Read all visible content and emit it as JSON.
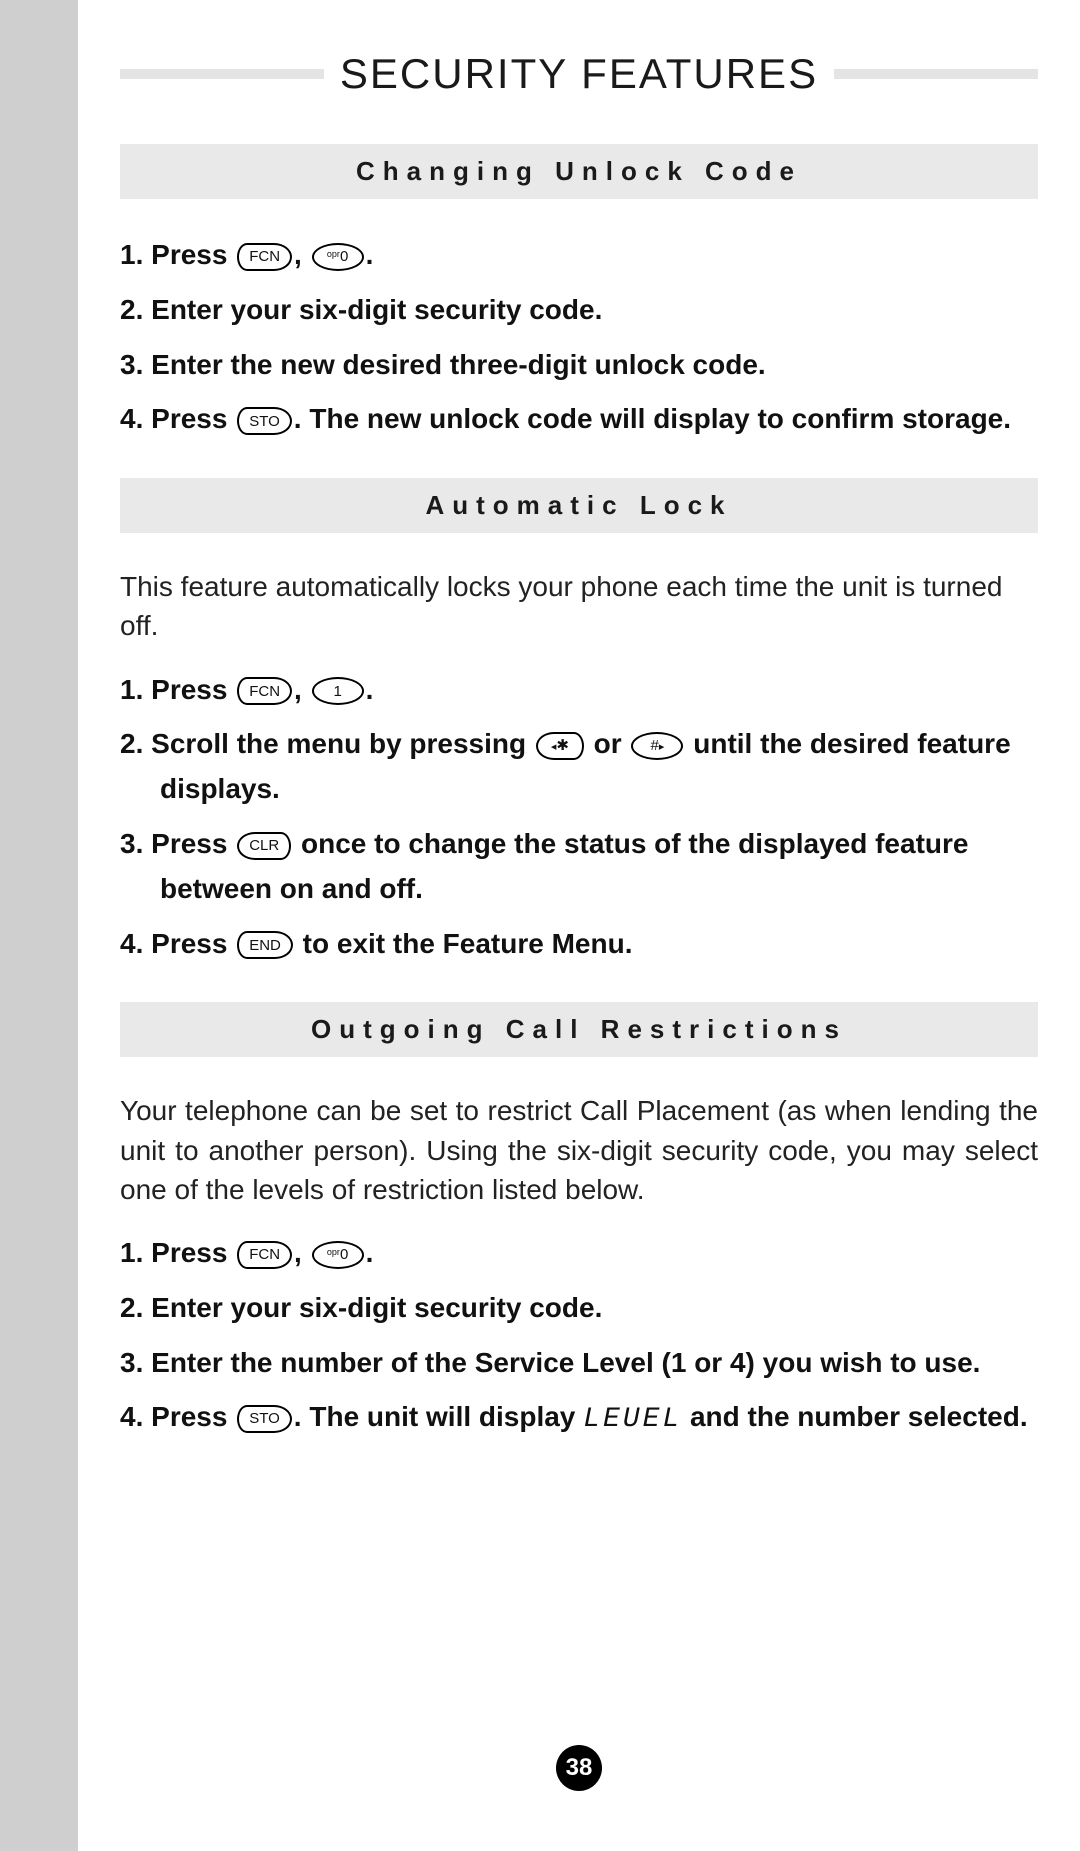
{
  "page_title": "SECURITY FEATURES",
  "page_number": "38",
  "keys": {
    "fcn": "FCN",
    "sto": "STO",
    "clr": "CLR",
    "end": "END",
    "zero_sup": "opr",
    "zero": "0",
    "one": "1",
    "star": "✱",
    "hash": "#"
  },
  "sections": {
    "changing": {
      "heading": "Changing Unlock Code",
      "steps": {
        "s1_a": "Press ",
        "s1_b": ", ",
        "s1_c": ".",
        "s2": "Enter your six-digit security code.",
        "s3": "Enter the new desired three-digit unlock code.",
        "s4_a": "Press ",
        "s4_b": ". The new unlock code will display to confirm storage."
      }
    },
    "auto": {
      "heading": "Automatic Lock",
      "intro": "This feature automatically locks your phone each time the unit is turned off.",
      "steps": {
        "s1_a": "Press ",
        "s1_b": ", ",
        "s1_c": ".",
        "s2_a": "Scroll the menu by pressing ",
        "s2_b": " or ",
        "s2_c": " until the desired feature displays.",
        "s3_a": "Press ",
        "s3_b": " once to change the status of the displayed feature between on and off.",
        "s4_a": "Press ",
        "s4_b": " to exit the Feature Menu."
      }
    },
    "outgoing": {
      "heading": "Outgoing Call Restrictions",
      "intro": "Your telephone can be set to restrict Call Placement (as when lending the unit to another person). Using the six-digit security code, you may select one of the levels of restriction listed below.",
      "steps": {
        "s1_a": "Press ",
        "s1_b": ", ",
        "s1_c": ".",
        "s2": "Enter your six-digit security code.",
        "s3": "Enter the number of the Service Level (1 or 4) you wish to use.",
        "s4_a": "Press ",
        "s4_b": ". The unit will display ",
        "s4_lcd": "LEUEL",
        "s4_c": " and the number selected."
      }
    }
  }
}
